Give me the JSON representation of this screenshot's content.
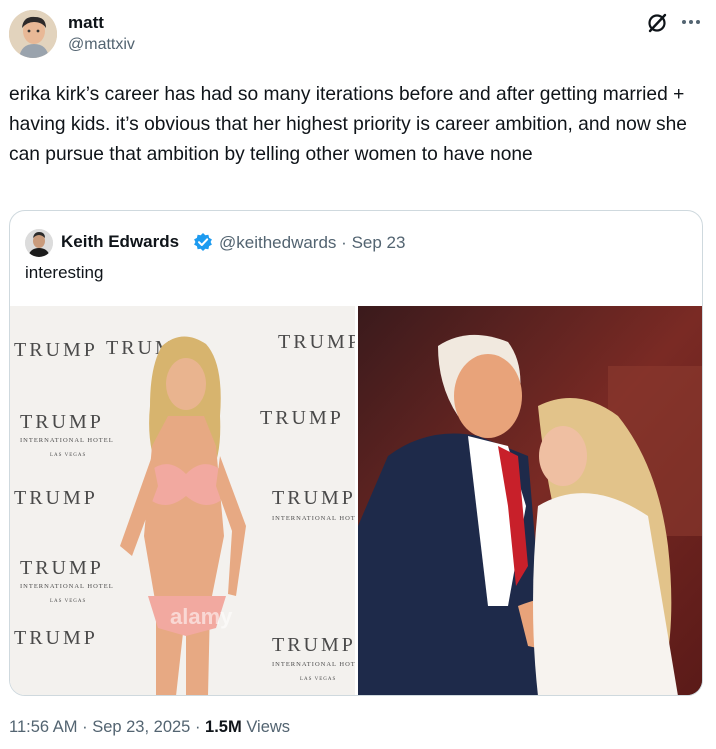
{
  "post": {
    "author": {
      "name": "matt",
      "handle": "@mattxiv"
    },
    "text": "erika kirk’s career has had so many iterations before and after getting married + having kids. it’s obvious that her highest priority is career ambition, and now she can pursue that ambition by telling other women to have none",
    "icons": {
      "grok": "grok-icon",
      "more": "more-icon"
    },
    "time": "11:56 AM",
    "separator": "·",
    "date": "Sep 23, 2025",
    "views_count": "1.5M",
    "views_label": "Views"
  },
  "quote": {
    "author": {
      "name": "Keith Edwards",
      "handle": "@keithedwards",
      "separator": "·",
      "date": "Sep 23",
      "verified": true
    },
    "text": "interesting",
    "images": [
      {
        "name": "photo-step-and-repeat",
        "backdrop_words": [
          "TRUMP",
          "INTERNATIONAL HOTEL",
          "LAS VEGAS"
        ],
        "watermark": "alamy"
      },
      {
        "name": "photo-embrace-on-stage"
      }
    ]
  },
  "colors": {
    "text": "#0f1419",
    "secondary": "#536471",
    "border": "#cfd9de",
    "verified": "#1d9bf0"
  }
}
